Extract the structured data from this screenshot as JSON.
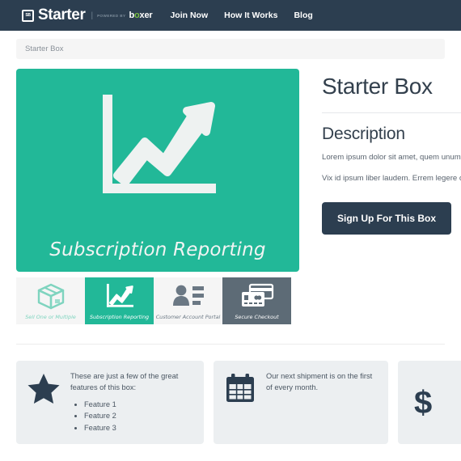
{
  "navbar": {
    "brand_mark_text": "SB",
    "brand_name": "Starter",
    "separator": "|",
    "powered_by": "POWERED BY",
    "boxer_pre": "b",
    "boxer_o": "o",
    "boxer_post": "xer",
    "links": [
      {
        "label": "Join Now",
        "name": "nav-join-now"
      },
      {
        "label": "How It Works",
        "name": "nav-how-it-works"
      },
      {
        "label": "Blog",
        "name": "nav-blog"
      }
    ]
  },
  "breadcrumb": {
    "current": "Starter Box"
  },
  "hero": {
    "caption": "Subscription Reporting",
    "background_color": "#22b898",
    "icon": "line-chart-up-arrow-icon"
  },
  "thumbnails": [
    {
      "label": "Sell One or Multiple",
      "icon": "box-package-icon",
      "state": "light",
      "name": "thumbnail-sell-one-or-multiple"
    },
    {
      "label": "Subscription Reporting",
      "icon": "line-chart-up-arrow-icon",
      "state": "active",
      "name": "thumbnail-subscription-reporting"
    },
    {
      "label": "Customer Account Portal",
      "icon": "user-profile-list-icon",
      "state": "gray",
      "name": "thumbnail-customer-account-portal"
    },
    {
      "label": "Secure Checkout",
      "icon": "credit-cards-icon",
      "state": "dark",
      "name": "thumbnail-secure-checkout"
    }
  ],
  "product": {
    "title": "Starter Box",
    "description_heading": "Description",
    "paragraphs": [
      "Lorem ipsum dolor sit amet, quem unum an mel, his te oportere constituam nec no, no hinc platonem theophrastus usu. No pro consulatu sit, ne mei dicam recusabo urbanitas, has ut quando alienum tibique detracto, mazim verterem ad eam. Ei est modus conceptam est ei.",
      "Vix id ipsum liber laudem. Errem legere obliquem no vis, sit te ex omnium laoreet graecis. Ad autem facilisi sed, usu in ullum magna, eripuit ornatus ea pro."
    ],
    "cta_label": "Sign Up For This Box"
  },
  "features": [
    {
      "name": "feature-box-features",
      "icon": "star-icon",
      "text": "These are just a few of the great features of this box:",
      "list": [
        "Feature 1",
        "Feature 2",
        "Feature 3"
      ]
    },
    {
      "name": "feature-box-shipment",
      "icon": "calendar-icon",
      "text": "Our next shipment is on the first of every month.",
      "list": []
    },
    {
      "name": "feature-box-price",
      "icon": "dollar-sign-icon",
      "text": "$",
      "list": []
    }
  ],
  "colors": {
    "navy": "#2c3e50",
    "teal": "#22b898",
    "dark_gray": "#5d6b76",
    "light_gray": "#eceff1"
  }
}
